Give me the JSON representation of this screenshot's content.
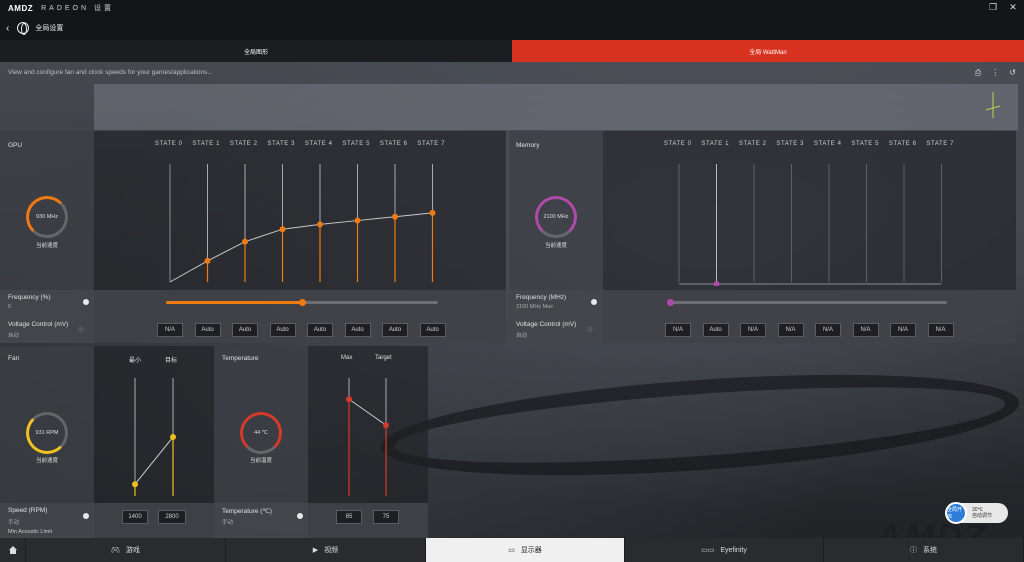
{
  "app": {
    "brand": "AMDZ",
    "brand_sub": "RADEON 设置",
    "window_restore_icon": "restore-icon",
    "window_close_icon": "close-icon",
    "page_title": "全局设置"
  },
  "tabs": [
    {
      "label": "全局图形",
      "active": false
    },
    {
      "label": "全局 WattMan",
      "active": true
    }
  ],
  "description": "View and configure fan and clock speeds for your games/applications...",
  "colors": {
    "accent": "#d7321f",
    "gpu": "#f07a12",
    "memory": "#b04aa8",
    "fan": "#f0c020",
    "temp": "#d43a2a",
    "toggle": "#2e7ed8"
  },
  "gpu": {
    "title": "GPU",
    "states": [
      "STATE 0",
      "STATE 1",
      "STATE 2",
      "STATE 3",
      "STATE 4",
      "STATE 5",
      "STATE 6",
      "STATE 7"
    ],
    "gauge_value": "930 MHz",
    "gauge_label": "当前速度",
    "freq_label": "Frequency (%)",
    "freq_value": "0",
    "freq_percent": 0.5,
    "voltage_label": "Voltage Control (mV)",
    "voltage_mode": "自动",
    "voltage_buttons": [
      "N/A",
      "Auto",
      "Auto",
      "Auto",
      "Auto",
      "Auto",
      "Auto",
      "Auto"
    ],
    "curve": [
      0,
      0.22,
      0.42,
      0.55,
      0.6,
      0.64,
      0.68,
      0.72
    ]
  },
  "memory": {
    "title": "Memory",
    "states": [
      "STATE 0",
      "STATE 1",
      "STATE 2",
      "STATE 3",
      "STATE 4",
      "STATE 5",
      "STATE 6",
      "STATE 7"
    ],
    "gauge_value": "2100 MHz",
    "gauge_label": "当前速度",
    "freq_label": "Frequency (MHz)",
    "freq_value": "2100 MHz Max",
    "freq_percent": 0.0,
    "voltage_label": "Voltage Control (mV)",
    "voltage_mode": "自动",
    "voltage_buttons": [
      "N/A",
      "Auto",
      "N/A",
      "N/A",
      "N/A",
      "N/A",
      "N/A",
      "N/A"
    ]
  },
  "fan": {
    "title": "Fan",
    "col_min": "最小",
    "col_target": "目标",
    "gauge_value": "931 RPM",
    "gauge_label": "当前速度",
    "speed_label": "Speed (RPM)",
    "speed_mode": "手动",
    "min_acoustic": "Min Acoustic Limit",
    "min_value": "1400",
    "target_value": "2800",
    "points": [
      0.1,
      0.5
    ]
  },
  "temperature": {
    "title": "Temperature",
    "col_max": "Max",
    "col_target": "Target",
    "gauge_value": "44 ℃",
    "gauge_label": "当前温度",
    "temp_label": "Temperature (℃)",
    "temp_mode": "手动",
    "max_value": "85",
    "target_value": "75",
    "points": [
      0.82,
      0.6
    ]
  },
  "toggle": {
    "state_label": "全局开启",
    "line1": "30℃",
    "line2": "自动调节"
  },
  "nav": [
    {
      "label": "",
      "icon": "home-icon"
    },
    {
      "label": "游戏",
      "icon": "gamepad-icon"
    },
    {
      "label": "视频",
      "icon": "play-icon"
    },
    {
      "label": "显示器",
      "icon": "monitor-icon",
      "active": true
    },
    {
      "label": "Eyefinity",
      "icon": "eyefinity-icon"
    },
    {
      "label": "系统",
      "icon": "info-icon"
    }
  ]
}
